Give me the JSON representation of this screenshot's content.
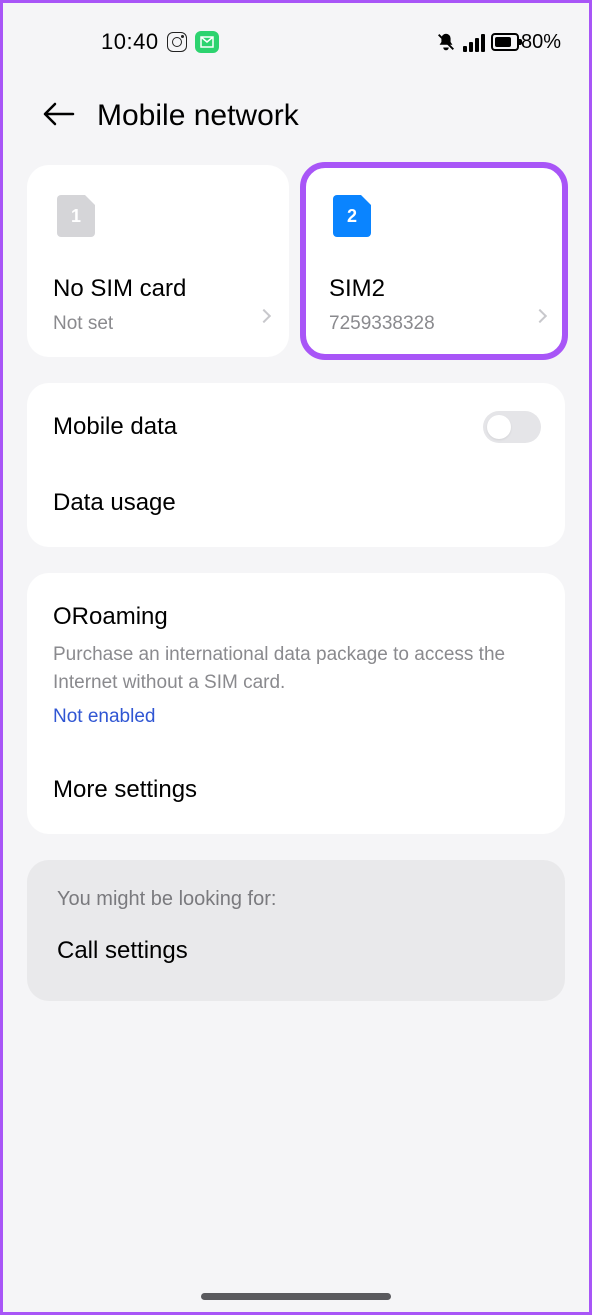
{
  "statusbar": {
    "time": "10:40",
    "battery_pct": "80%"
  },
  "header": {
    "title": "Mobile network"
  },
  "sims": [
    {
      "num": "1",
      "title": "No SIM card",
      "sub": "Not set"
    },
    {
      "num": "2",
      "title": "SIM2",
      "sub": "7259338328"
    }
  ],
  "dataGroup": {
    "mobile_data": "Mobile data",
    "data_usage": "Data usage"
  },
  "roamingGroup": {
    "title": "ORoaming",
    "desc": "Purchase an international data package to access the Internet without a SIM card.",
    "status": "Not enabled",
    "more": "More settings"
  },
  "suggestion": {
    "label": "You might be looking for:",
    "item": "Call settings"
  }
}
